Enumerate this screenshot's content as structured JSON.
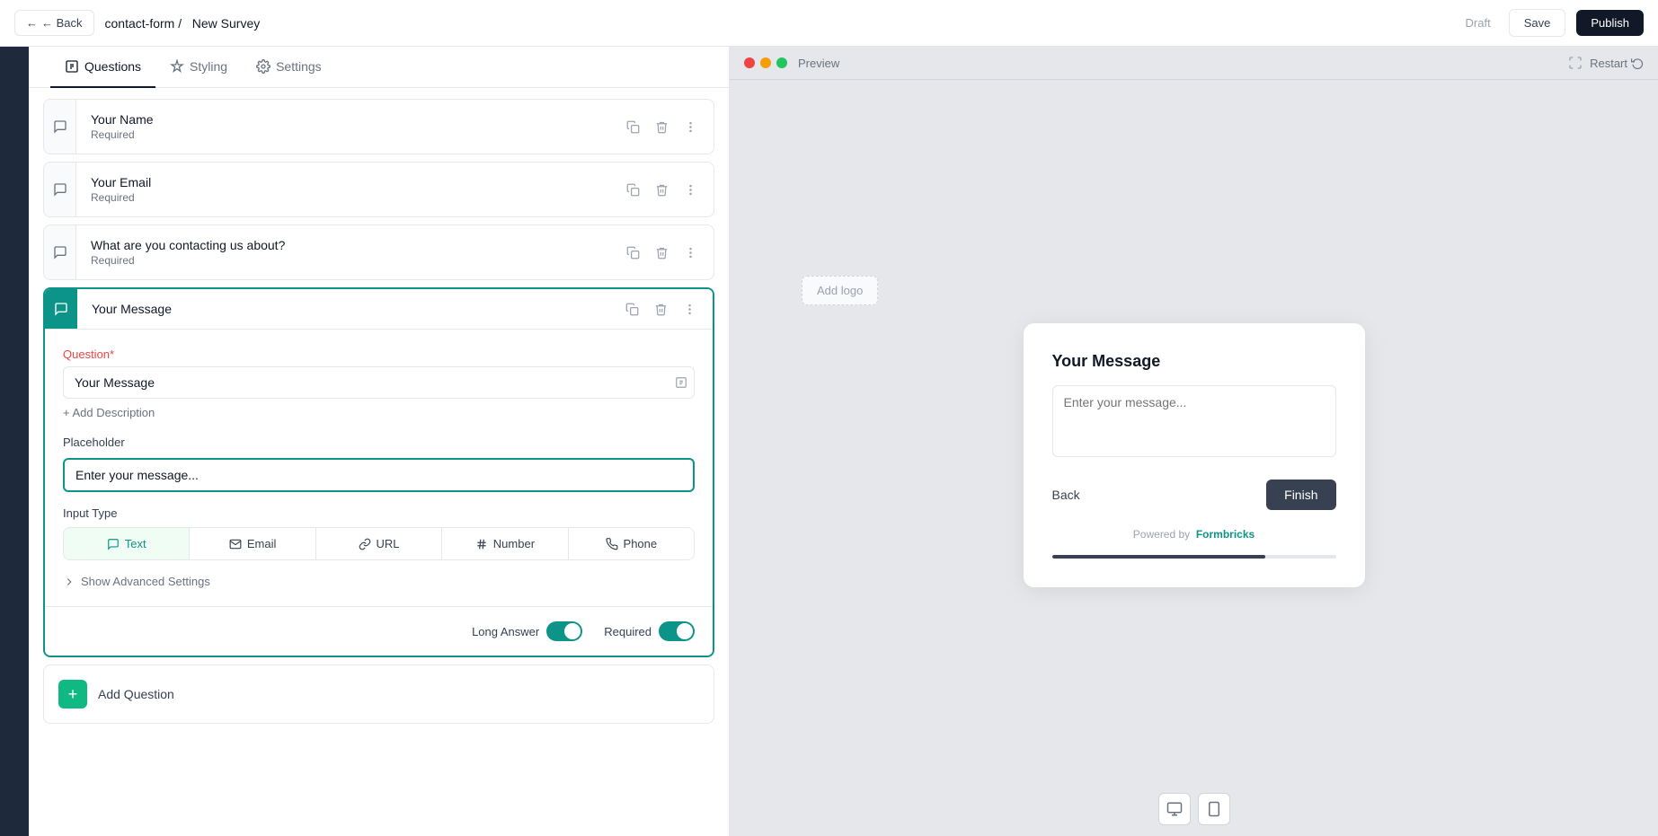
{
  "topnav": {
    "back_label": "← Back",
    "breadcrumb_parent": "contact-form /",
    "breadcrumb_current": "New Survey",
    "draft_label": "Draft",
    "save_label": "Save",
    "publish_label": "Publish"
  },
  "tabs": [
    {
      "id": "questions",
      "label": "Questions",
      "active": true
    },
    {
      "id": "styling",
      "label": "Styling",
      "active": false
    },
    {
      "id": "settings",
      "label": "Settings",
      "active": false
    }
  ],
  "questions": [
    {
      "id": "q1",
      "title": "Your Name",
      "required": "Required",
      "active": false
    },
    {
      "id": "q2",
      "title": "Your Email",
      "required": "Required",
      "active": false
    },
    {
      "id": "q3",
      "title": "What are you contacting us about?",
      "required": "Required",
      "active": false
    }
  ],
  "active_question": {
    "title": "Your Message",
    "field_label": "Question",
    "field_required_marker": "*",
    "question_value": "Your Message",
    "add_description_label": "+ Add Description",
    "placeholder_label": "Placeholder",
    "placeholder_value": "Enter your message...",
    "input_type_label": "Input Type",
    "input_types": [
      {
        "id": "text",
        "label": "Text",
        "active": true
      },
      {
        "id": "email",
        "label": "Email",
        "active": false
      },
      {
        "id": "url",
        "label": "URL",
        "active": false
      },
      {
        "id": "number",
        "label": "Number",
        "active": false
      },
      {
        "id": "phone",
        "label": "Phone",
        "active": false
      }
    ],
    "advanced_settings_label": "Show Advanced Settings",
    "long_answer_label": "Long Answer",
    "long_answer_enabled": true,
    "required_label": "Required",
    "required_enabled": true
  },
  "add_question": {
    "label": "Add Question"
  },
  "preview": {
    "toolbar_label": "Preview",
    "restart_label": "Restart",
    "add_logo_label": "Add logo",
    "card": {
      "title": "Your Message",
      "textarea_placeholder": "Enter your message...",
      "back_label": "Back",
      "finish_label": "Finish",
      "powered_by_text": "Powered by",
      "powered_by_brand": "Formbricks",
      "progress_pct": 75
    }
  },
  "device_icons": {
    "desktop_label": "desktop-view",
    "mobile_label": "mobile-view"
  }
}
